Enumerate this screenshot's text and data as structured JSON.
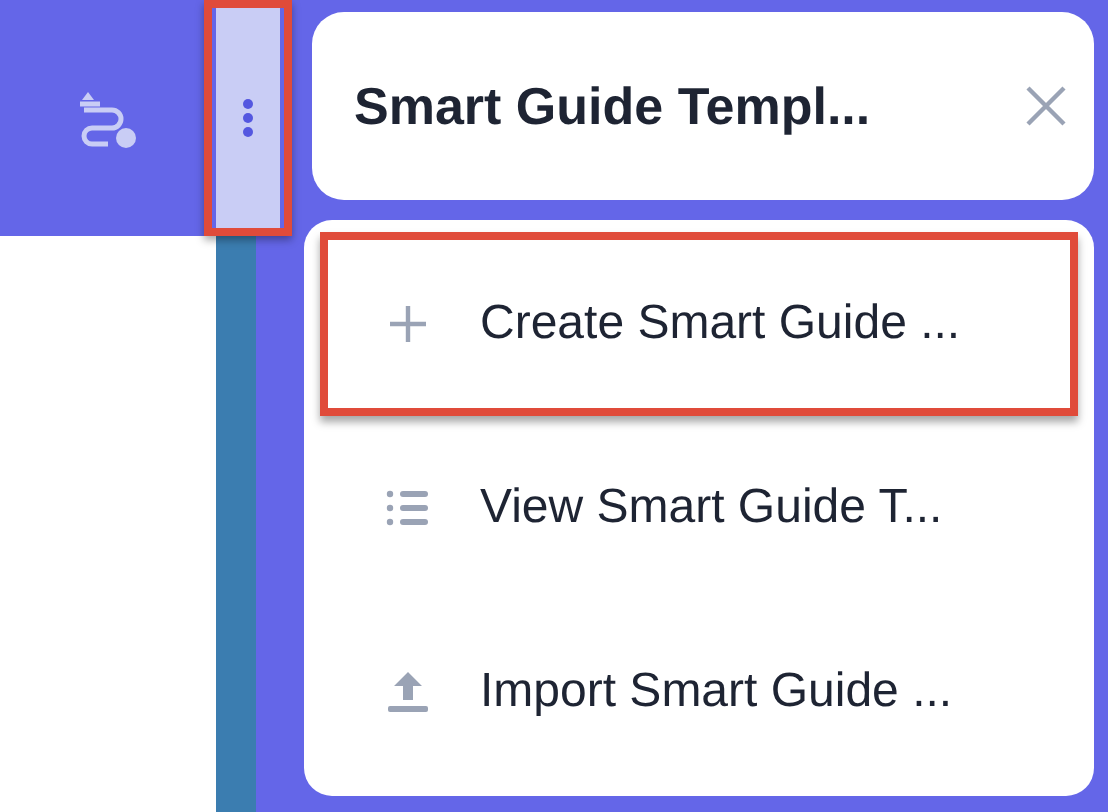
{
  "sidebar": {
    "kebab_highlighted": true
  },
  "panel": {
    "title": "Smart Guide Templ...",
    "menu": [
      {
        "kind": "create",
        "label": "Create Smart Guide ...",
        "highlighted": true
      },
      {
        "kind": "view",
        "label": "View Smart Guide T...",
        "highlighted": false
      },
      {
        "kind": "import",
        "label": "Import Smart Guide ...",
        "highlighted": false
      }
    ]
  }
}
